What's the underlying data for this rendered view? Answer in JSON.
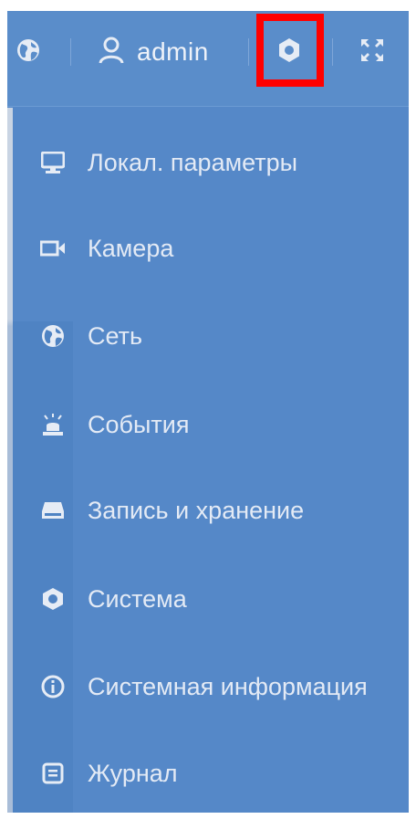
{
  "header": {
    "username": "admin",
    "icons": [
      "globe-icon",
      "user-icon",
      "gear-icon",
      "fullscreen-icon"
    ]
  },
  "menu": {
    "items": [
      {
        "label": "Локал. параметры",
        "icon": "monitor-icon"
      },
      {
        "label": "Камера",
        "icon": "camera-icon"
      },
      {
        "label": "Сеть",
        "icon": "globe-icon"
      },
      {
        "label": "События",
        "icon": "alarm-icon"
      },
      {
        "label": "Запись и хранение",
        "icon": "storage-icon"
      },
      {
        "label": "Система",
        "icon": "gear-icon"
      },
      {
        "label": "Системная информация",
        "icon": "info-icon"
      },
      {
        "label": "Журнал",
        "icon": "log-icon"
      }
    ]
  },
  "colors": {
    "background": "#5588c8",
    "text": "#e3eaf5",
    "highlight": "#ff0000"
  }
}
